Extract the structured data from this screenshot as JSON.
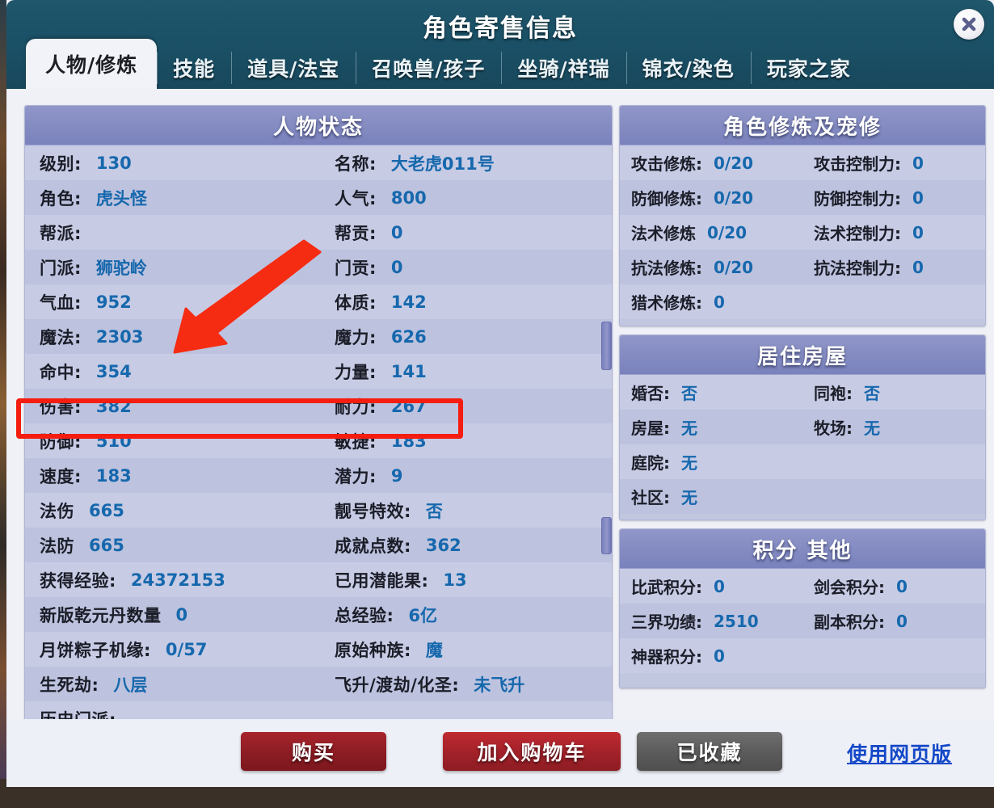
{
  "window": {
    "title": "角色寄售信息",
    "close_icon": "close-icon"
  },
  "tabs": [
    {
      "label": "人物/修炼",
      "active": true
    },
    {
      "label": "技能",
      "active": false
    },
    {
      "label": "道具/法宝",
      "active": false
    },
    {
      "label": "召唤兽/孩子",
      "active": false
    },
    {
      "label": "坐骑/祥瑞",
      "active": false
    },
    {
      "label": "锦衣/染色",
      "active": false
    },
    {
      "label": "玩家之家",
      "active": false
    }
  ],
  "status_panel": {
    "title": "人物状态",
    "rows": [
      {
        "l_label": "级别:",
        "l_value": "130",
        "r_label": "名称:",
        "r_value": "大老虎011号"
      },
      {
        "l_label": "角色:",
        "l_value": "虎头怪",
        "r_label": "人气:",
        "r_value": "800"
      },
      {
        "l_label": "帮派:",
        "l_value": "",
        "r_label": "帮贡:",
        "r_value": "0"
      },
      {
        "l_label": "门派:",
        "l_value": "狮驼岭",
        "r_label": "门贡:",
        "r_value": "0"
      },
      {
        "l_label": "气血:",
        "l_value": "952",
        "r_label": "体质:",
        "r_value": "142"
      },
      {
        "l_label": "魔法:",
        "l_value": "2303",
        "r_label": "魔力:",
        "r_value": "626"
      },
      {
        "l_label": "命中:",
        "l_value": "354",
        "r_label": "力量:",
        "r_value": "141"
      },
      {
        "l_label": "伤害:",
        "l_value": "382",
        "r_label": "耐力:",
        "r_value": "267"
      },
      {
        "l_label": "防御:",
        "l_value": "510",
        "r_label": "敏捷:",
        "r_value": "183"
      },
      {
        "l_label": "速度:",
        "l_value": "183",
        "r_label": "潜力:",
        "r_value": "9"
      },
      {
        "l_label": "法伤",
        "l_value": "665",
        "r_label": "靓号特效:",
        "r_value": "否"
      },
      {
        "l_label": "法防",
        "l_value": "665",
        "r_label": "成就点数:",
        "r_value": "362"
      },
      {
        "l_label": "获得经验:",
        "l_value": "24372153",
        "r_label": "已用潜能果:",
        "r_value": "13"
      },
      {
        "l_label": "新版乾元丹数量",
        "l_value": "0",
        "r_label": "总经验:",
        "r_value": "6亿"
      },
      {
        "l_label": "月饼粽子机缘:",
        "l_value": "0/57",
        "r_label": "原始种族:",
        "r_value": "魔"
      },
      {
        "l_label": "生死劫:",
        "l_value": "八层",
        "r_label": "飞升/渡劫/化圣:",
        "r_value": "未飞升"
      },
      {
        "l_label": "历史门派:",
        "l_value": "",
        "r_label": "",
        "r_value": ""
      }
    ]
  },
  "cultivation_panel": {
    "title": "角色修炼及宠修",
    "rows": [
      {
        "c1_label": "攻击修炼:",
        "c1_value": "0/20",
        "c2_label": "攻击控制力:",
        "c2_value": "0"
      },
      {
        "c1_label": "防御修炼:",
        "c1_value": "0/20",
        "c2_label": "防御控制力:",
        "c2_value": "0"
      },
      {
        "c1_label": "法术修炼",
        "c1_value": "0/20",
        "c2_label": "法术控制力:",
        "c2_value": "0"
      },
      {
        "c1_label": "抗法修炼:",
        "c1_value": "0/20",
        "c2_label": "抗法控制力:",
        "c2_value": "0"
      },
      {
        "c1_label": "猎术修炼:",
        "c1_value": "0",
        "c2_label": "",
        "c2_value": ""
      }
    ]
  },
  "house_panel": {
    "title": "居住房屋",
    "rows": [
      {
        "c1_label": "婚否:",
        "c1_value": "否",
        "c2_label": "同袍:",
        "c2_value": "否"
      },
      {
        "c1_label": "房屋:",
        "c1_value": "无",
        "c2_label": "牧场:",
        "c2_value": "无"
      },
      {
        "c1_label": "庭院:",
        "c1_value": "无",
        "c2_label": "",
        "c2_value": ""
      },
      {
        "c1_label": "社区:",
        "c1_value": "无",
        "c2_label": "",
        "c2_value": ""
      }
    ]
  },
  "score_panel": {
    "title": "积分 其他",
    "rows": [
      {
        "c1_label": "比武积分:",
        "c1_value": "0",
        "c2_label": "剑会积分:",
        "c2_value": "0"
      },
      {
        "c1_label": "三界功绩:",
        "c1_value": "2510",
        "c2_label": "副本积分:",
        "c2_value": "0"
      },
      {
        "c1_label": "神器积分:",
        "c1_value": "0",
        "c2_label": "",
        "c2_value": ""
      }
    ]
  },
  "footer": {
    "buy_label": "购买",
    "cart_label": "加入购物车",
    "fav_label": "已收藏",
    "web_link_label": "使用网页版"
  },
  "annotations": {
    "highlight_color": "#f51d10",
    "arrow_target": "门派",
    "box_target": "魔法 / 魔力"
  }
}
